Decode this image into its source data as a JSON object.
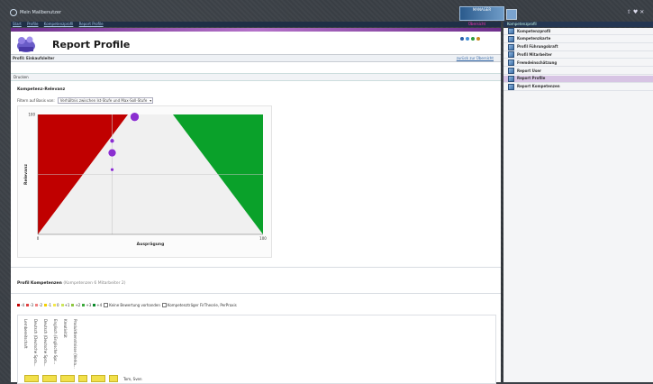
{
  "top": {
    "home_link": "Mein Mailbenutzer",
    "brand_label": "MANAGER",
    "top_icons": "⇧ ♥ ✕"
  },
  "breadcrumb": [
    "Start",
    "Profile",
    "Kompetenzprofil",
    "Report Profile"
  ],
  "breadcrumb_right": "Übersicht",
  "side_header": "Kompetenzprofil",
  "page": {
    "title": "Report Profile",
    "subtitle_left": "Profil: Einkaufsleiter",
    "subtitle_right": "zurück zur Übersicht",
    "tool_label": "Drucken",
    "section_relevance": "Kompetenz-Relevanz",
    "filter_label": "Filtern auf Basis von:",
    "filter_value": "Verhältnis zwischen Ist-Stufe und Max-Soll-Stufe",
    "section_profile": "Profil Kompetenzen",
    "section_profile_note": "(Kompetenzen 6 Mitarbeiter 2)",
    "status_colors": [
      "#2a5fa8",
      "#3e8fd6",
      "#2e9b3e",
      "#c88a20"
    ]
  },
  "chart_data": {
    "type": "scatter",
    "ylabel": "Relevanz",
    "xlabel": "Ausprägung",
    "xlim": [
      0,
      100
    ],
    "ylim": [
      0,
      100
    ],
    "x_ticks": [
      "0",
      "100"
    ],
    "y_ticks": [
      "100"
    ],
    "regions": {
      "left": "#c00000",
      "right": "#0aa12a",
      "middle": "#f0f0f0"
    },
    "series": [
      {
        "points": [
          {
            "x": 43,
            "y": 98,
            "size": 5
          },
          {
            "x": 33,
            "y": 78,
            "size": 2.5
          },
          {
            "x": 33,
            "y": 68,
            "size": 4.5
          },
          {
            "x": 33,
            "y": 54,
            "size": 2
          }
        ],
        "color": "#8b2fd0"
      }
    ]
  },
  "legend": {
    "items": [
      {
        "label": "-4",
        "color": "#c00000"
      },
      {
        "label": "-3",
        "color": "#e04040"
      },
      {
        "label": "-2",
        "color": "#f08080"
      },
      {
        "label": "-1",
        "color": "#f4d000"
      },
      {
        "label": "0",
        "color": "#f4e84a"
      },
      {
        "label": "+1",
        "color": "#cde65c"
      },
      {
        "label": "+2",
        "color": "#8cc63f"
      },
      {
        "label": "+3",
        "color": "#3aa83a"
      },
      {
        "label": "+4",
        "color": "#0a8a2a"
      }
    ],
    "extra1": "Keine Bewertung vorhanden",
    "extra2": "Kompetenzträger FirTheorie, PerPraxis"
  },
  "competences": [
    "Lernbereitschaft",
    "Deutsch (Deutsche Spra...",
    "Deutsch (Deutsche Spra...",
    "Englisch (Englische Spr...",
    "Kreativität",
    "Produktkenntnisse (Verka..."
  ],
  "score_label": "Tom, Sven",
  "sidebar": {
    "items": [
      {
        "label": "Kompetenzprofil"
      },
      {
        "label": "Kompetenzkarte"
      },
      {
        "label": "Profil Führungskraft"
      },
      {
        "label": "Profil Mitarbeiter"
      },
      {
        "label": "Fremdeinschätzung"
      },
      {
        "label": "Report User"
      },
      {
        "label": "Report Profile"
      },
      {
        "label": "Report Kompetenzen"
      }
    ]
  }
}
